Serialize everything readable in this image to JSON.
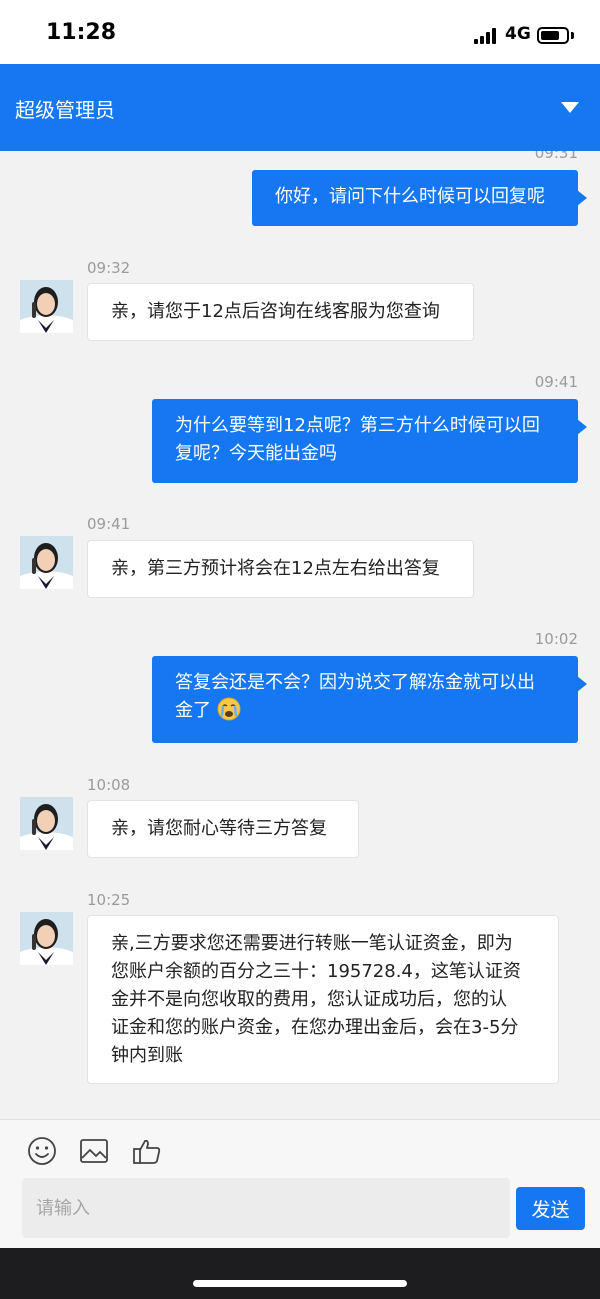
{
  "status_bar": {
    "time": "11:28",
    "network": "4G",
    "battery_level": 0.75
  },
  "header": {
    "title": "超级管理员",
    "dropdown_icon": "triangle-down-icon"
  },
  "messages": [
    {
      "direction": "outgoing",
      "time": "09:31",
      "lines": [
        "你好，请问下什么时候可以回复呢"
      ]
    },
    {
      "direction": "incoming",
      "time": "09:32",
      "lines": [
        "亲，请您于12点后咨询在线客服为您查询"
      ]
    },
    {
      "direction": "outgoing",
      "time": "09:41",
      "lines": [
        "为什么要等到12点呢？第三方什么时候可以回",
        "复呢？今天能出金吗"
      ]
    },
    {
      "direction": "incoming",
      "time": "09:41",
      "lines": [
        "亲，第三方预计将会在12点左右给出答复"
      ]
    },
    {
      "direction": "outgoing",
      "time": "10:02",
      "lines": [
        "答复会还是不会？因为说交了解冻金就可以出",
        "金了"
      ],
      "emoji": "crying-face-icon"
    },
    {
      "direction": "incoming",
      "time": "10:08",
      "lines": [
        "亲，请您耐心等待三方答复"
      ]
    },
    {
      "direction": "incoming",
      "time": "10:25",
      "lines": [
        "亲,三方要求您还需要进行转账一笔认证资金，即为",
        "您账户余额的百分之三十：195728.4，这笔认证资",
        "金并不是向您收取的费用，您认证成功后，您的认",
        "证金和您的账户资金，在您办理出金后，会在3-5分",
        "钟内到账"
      ]
    }
  ],
  "toolbar": {
    "icons": [
      "emoji-icon",
      "image-icon",
      "thumbs-up-icon"
    ],
    "input_placeholder": "请输入",
    "send_label": "发送"
  },
  "colors": {
    "accent": "#1677f3",
    "chat_background": "#f2f2f2",
    "incoming_bubble": "#ffffff"
  }
}
